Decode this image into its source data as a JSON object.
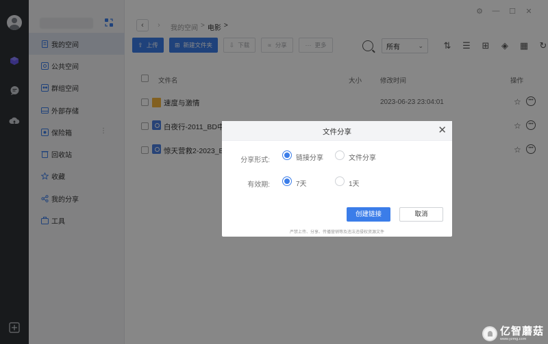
{
  "sidebar": {
    "items": [
      {
        "label": "我的空间",
        "icon": "doc-icon",
        "active": true
      },
      {
        "label": "公共空间",
        "icon": "public-space-icon"
      },
      {
        "label": "群组空间",
        "icon": "group-space-icon"
      },
      {
        "label": "外部存储",
        "icon": "external-storage-icon"
      },
      {
        "label": "保险箱",
        "icon": "safe-icon",
        "more": "⋮"
      },
      {
        "label": "回收站",
        "icon": "recycle-bin-icon"
      },
      {
        "label": "收藏",
        "icon": "star-icon"
      },
      {
        "label": "我的分享",
        "icon": "share-icon"
      },
      {
        "label": "工具",
        "icon": "toolbox-icon"
      }
    ]
  },
  "window": {
    "settings": "⚙",
    "minimize": "—",
    "maximize": "☐",
    "close": "✕"
  },
  "nav": {
    "back": "‹",
    "forward": "›"
  },
  "breadcrumb": {
    "root": "我的空间",
    "sep1": ">",
    "current": "电影",
    "sep2": ">"
  },
  "toolbar": {
    "upload": "上传",
    "new_folder": "新建文件夹",
    "download": "下载",
    "share": "分享",
    "more": "更多"
  },
  "filter": {
    "selected": "所有"
  },
  "table": {
    "headers": {
      "name": "文件名",
      "size": "大小",
      "mtime": "修改时间",
      "ops": "操作"
    },
    "rows": [
      {
        "name": "速度与激情",
        "type": "folder",
        "mtime": "2023-06-23 23:04:01"
      },
      {
        "name": "白夜行-2011_BD中",
        "type": "video",
        "mtime": ""
      },
      {
        "name": "惊天营救2-2023_BD",
        "type": "video",
        "mtime": ""
      }
    ]
  },
  "dialog": {
    "title": "文件分享",
    "close": "✕",
    "share_form_label": "分享形式:",
    "share_form_options": [
      "链接分享",
      "文件分享"
    ],
    "share_form_selected": "链接分享",
    "validity_label": "有效期:",
    "validity_options": [
      "7天",
      "1天"
    ],
    "validity_selected": "7天",
    "create_button": "创建链接",
    "cancel_button": "取消",
    "note": "严禁上传、分享、传播营销等及违法违侵权资源文件"
  },
  "watermark": {
    "brand": "亿智蘑菇",
    "url": "www.yzmg.com"
  },
  "colors": {
    "primary": "#3b7de9",
    "folder": "#f5b63d",
    "rail": "#2f3235",
    "sidebar_active": "#dde3ef"
  }
}
